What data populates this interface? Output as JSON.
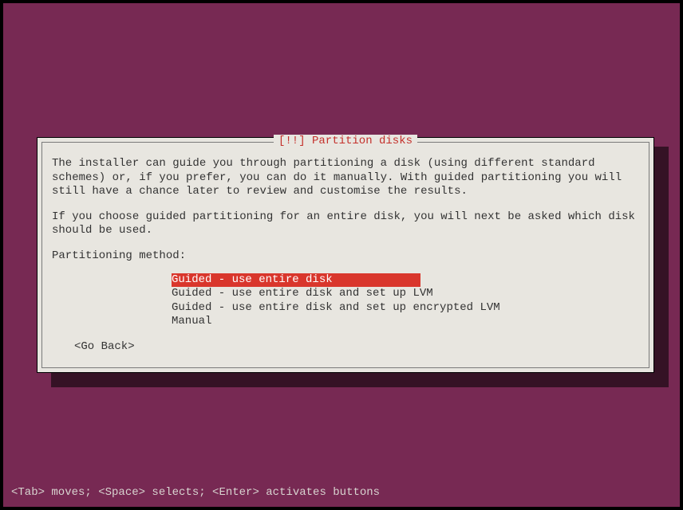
{
  "dialog": {
    "title": "[!!] Partition disks",
    "paragraph1": "The installer can guide you through partitioning a disk (using different standard schemes) or, if you prefer, you can do it manually. With guided partitioning you will still have a chance later to review and customise the results.",
    "paragraph2": "If you choose guided partitioning for an entire disk, you will next be asked which disk should be used.",
    "prompt": "Partitioning method:",
    "options": [
      "Guided - use entire disk",
      "Guided - use entire disk and set up LVM",
      "Guided - use entire disk and set up encrypted LVM",
      "Manual"
    ],
    "go_back": "<Go Back>"
  },
  "footer": "<Tab> moves; <Space> selects; <Enter> activates buttons"
}
